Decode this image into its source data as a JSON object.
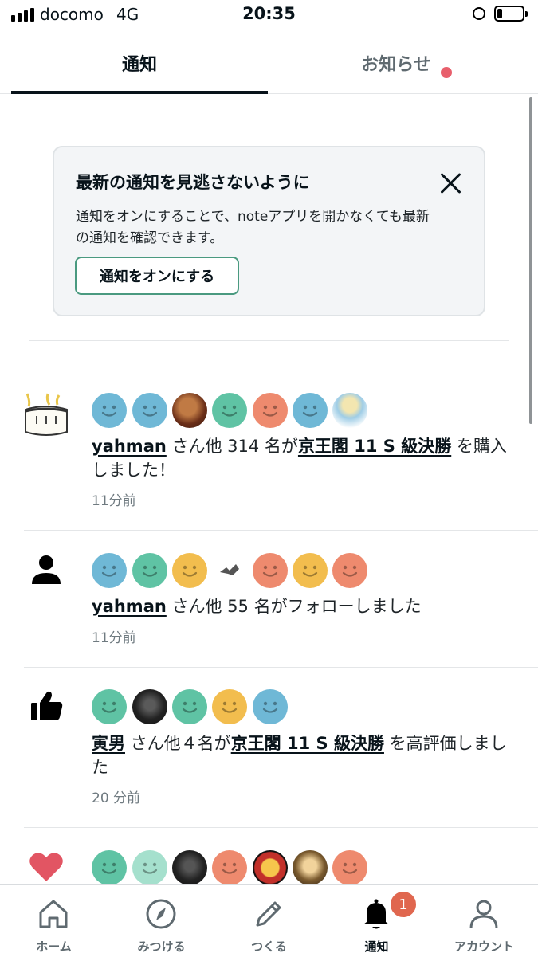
{
  "status_bar": {
    "carrier": "docomo",
    "network": "4G",
    "time": "20:35",
    "battery_level": 0.15
  },
  "tabs": [
    {
      "label": "通知",
      "active": true
    },
    {
      "label": "お知らせ",
      "active": false,
      "has_dot": true
    }
  ],
  "promo_card": {
    "title": "最新の通知を見逃さないように",
    "body": "通知をオンにすることで、noteアプリを開かなくても最新の通知を確認できます。",
    "button_label": "通知をオンにする",
    "close_icon": "close-icon"
  },
  "notifications": [
    {
      "type_icon": "article-thumbnail",
      "user": "yahman",
      "middle": " さん他 314 名が",
      "article": "京王閣 11 S 級決勝",
      "suffix": " を購入しました！",
      "time": "11分前"
    },
    {
      "type_icon": "person-icon",
      "user": "yahman",
      "middle": " さん他 55 名がフォローしました",
      "article": "",
      "suffix": "",
      "time": "11分前"
    },
    {
      "type_icon": "thumbs-up-icon",
      "user": "寅男",
      "middle": " さん他４名が",
      "article": "京王閣 11 S 級決勝",
      "suffix": " を高評価しました",
      "time": "20 分前"
    },
    {
      "type_icon": "heart-icon",
      "user": "",
      "middle": "",
      "article": "",
      "suffix": "",
      "time": ""
    }
  ],
  "bottom_nav": [
    {
      "label": "ホーム",
      "icon": "home-icon"
    },
    {
      "label": "みつける",
      "icon": "compass-icon"
    },
    {
      "label": "つくる",
      "icon": "pencil-icon"
    },
    {
      "label": "通知",
      "icon": "bell-icon",
      "active": true,
      "badge": "1"
    },
    {
      "label": "アカウント",
      "icon": "account-icon"
    }
  ],
  "colors": {
    "face_blue": "#6fb8d6",
    "face_green": "#5fc3a4",
    "face_yellow": "#f2bd4e",
    "face_salmon": "#ee8a6e",
    "face_mint": "#a5e0cd",
    "accent_green": "#4a9a80",
    "heart_red": "#e25563",
    "badge_red": "#e0674f"
  }
}
